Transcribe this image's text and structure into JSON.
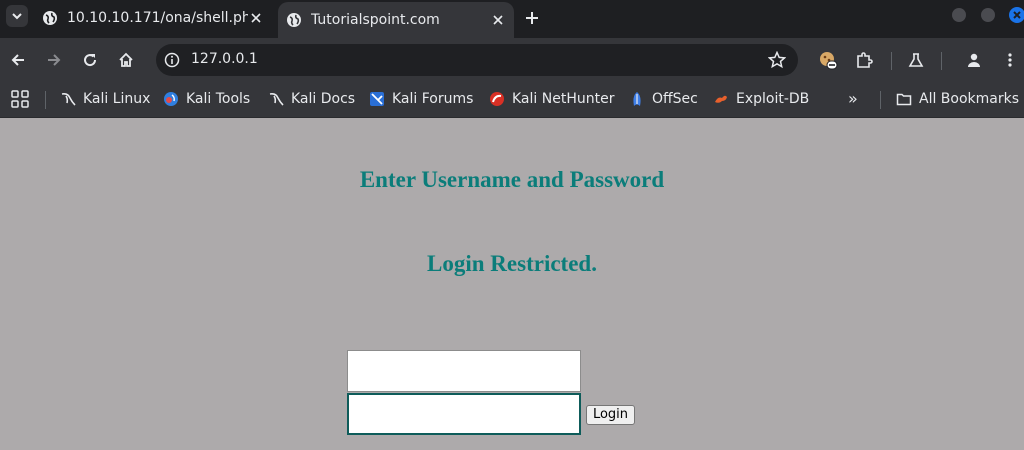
{
  "browser": {
    "tabs": [
      {
        "title": "10.10.10.171/ona/shell.ph",
        "active": false,
        "favicon": "globe-icon"
      },
      {
        "title": "Tutorialspoint.com",
        "active": true,
        "favicon": "globe-icon"
      }
    ],
    "new_tab_icon": "plus-icon",
    "url": "127.0.0.1",
    "bookmarks": [
      {
        "label": "Kali Linux",
        "icon": "kali-dragon-icon"
      },
      {
        "label": "Kali Tools",
        "icon": "kali-tools-icon"
      },
      {
        "label": "Kali Docs",
        "icon": "kali-dragon-icon"
      },
      {
        "label": "Kali Forums",
        "icon": "kali-forums-icon"
      },
      {
        "label": "Kali NetHunter",
        "icon": "nethunter-icon"
      },
      {
        "label": "OffSec",
        "icon": "offsec-icon"
      },
      {
        "label": "Exploit-DB",
        "icon": "exploit-db-icon"
      }
    ],
    "bookmarks_overflow": "»",
    "all_bookmarks_label": "All Bookmarks",
    "colors": {
      "tabstrip": "#1e1f22",
      "toolbar": "#35363a",
      "accent": "#1a73e8"
    }
  },
  "page": {
    "heading": "Enter Username and Password",
    "subheading": "Login Restricted.",
    "username_value": "",
    "password_value": "",
    "login_button": "Login",
    "colors": {
      "background": "#adaaab",
      "heading": "#0b7d7a"
    }
  }
}
